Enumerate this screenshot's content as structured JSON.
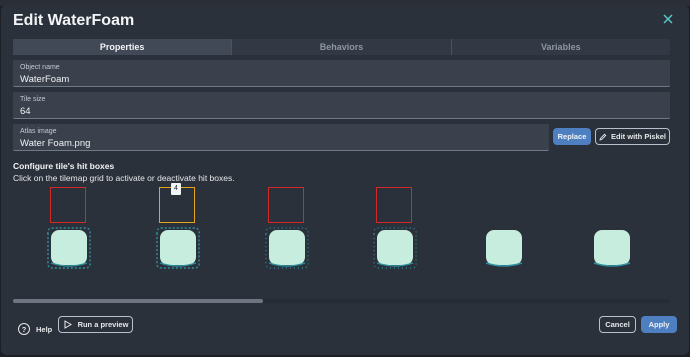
{
  "dialog": {
    "title": "Edit WaterFoam",
    "close_icon": "close-icon"
  },
  "tabs": [
    {
      "label": "Properties",
      "active": true
    },
    {
      "label": "Behaviors",
      "active": false
    },
    {
      "label": "Variables",
      "active": false
    }
  ],
  "fields": {
    "object_name": {
      "label": "Object name",
      "value": "WaterFoam"
    },
    "tile_size": {
      "label": "Tile size",
      "value": "64"
    },
    "atlas_image": {
      "label": "Atlas image",
      "value": "Water Foam.png"
    }
  },
  "atlas_buttons": {
    "replace": "Replace",
    "edit_piskel": "Edit with Piskel",
    "edit_icon": "pencil-icon"
  },
  "hitboxes": {
    "title": "Configure tile's hit boxes",
    "subtitle": "Click on the tilemap grid to activate or deactivate hit boxes.",
    "selected_tooltip": "4",
    "colors": {
      "active": "#d42828",
      "selected": "#e8a31c",
      "foam": "#c6eddd",
      "foam_edge": "#2f8fa0"
    }
  },
  "footer": {
    "help": "Help",
    "help_icon": "question-circle-icon",
    "preview": "Run a preview",
    "preview_icon": "play-icon",
    "cancel": "Cancel",
    "apply": "Apply"
  },
  "colors": {
    "accent": "#4e7fc1",
    "close": "#55c8c8"
  }
}
